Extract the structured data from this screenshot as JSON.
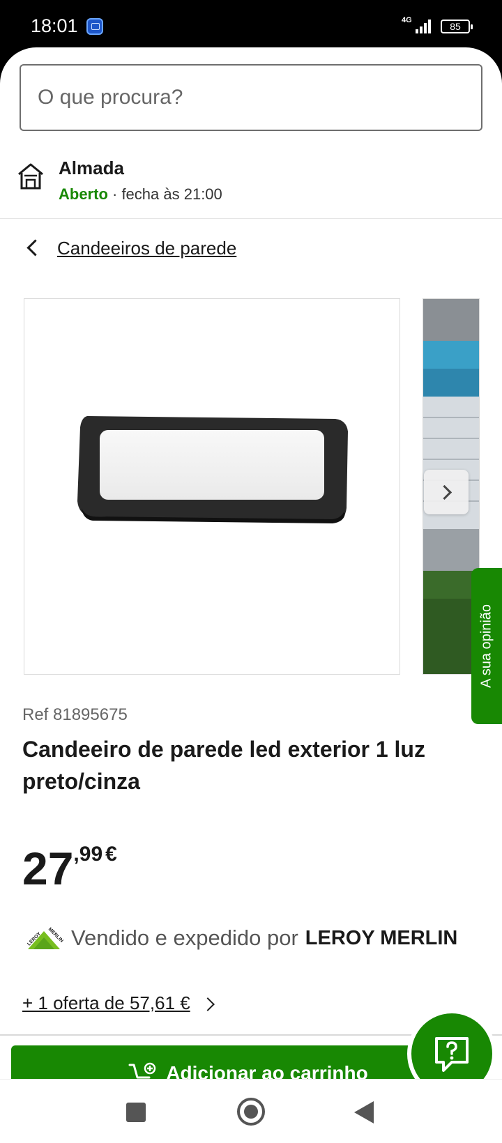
{
  "status_bar": {
    "time": "18:01",
    "network": "4G",
    "battery": "85"
  },
  "search": {
    "placeholder": "O que procura?"
  },
  "store": {
    "name": "Almada",
    "status": "Aberto",
    "hours": " · fecha às 21:00"
  },
  "breadcrumb": {
    "label": "Candeeiros de parede"
  },
  "feedback": {
    "label": "A sua opinião"
  },
  "product": {
    "ref": "Ref 81895675",
    "title": "Candeeiro de parede led exterior 1 luz preto/cinza",
    "price_integer": "27",
    "price_decimal": ",99",
    "price_currency": "€"
  },
  "seller": {
    "text": "Vendido e expedido por",
    "brand": "LEROY MERLIN"
  },
  "offer": {
    "label": "+ 1 oferta de 57,61 €"
  },
  "cart": {
    "label": "Adicionar ao carrinho"
  },
  "colors": {
    "brand_green": "#188803",
    "text": "#1a1a1a",
    "muted": "#666666"
  }
}
